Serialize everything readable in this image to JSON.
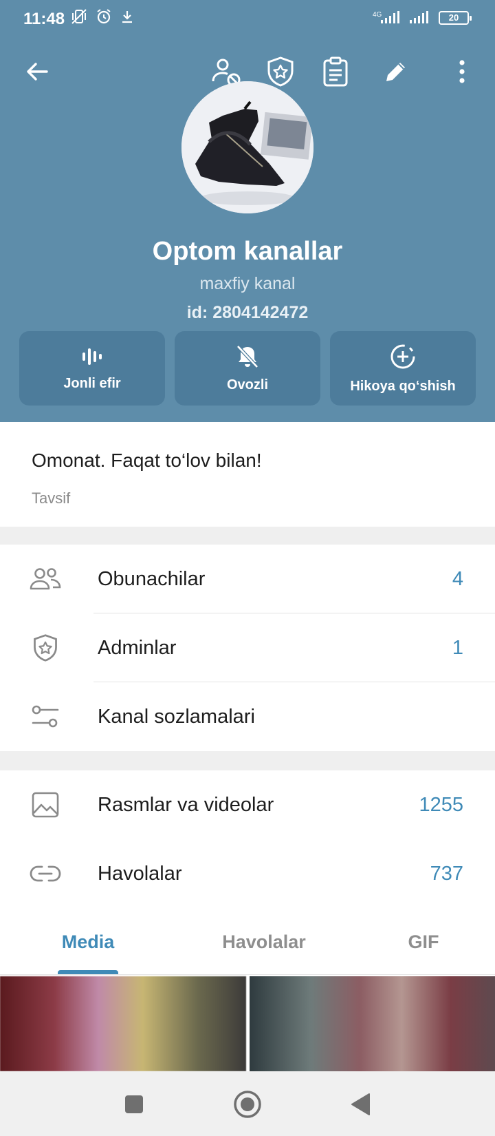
{
  "status_bar": {
    "time": "11:48",
    "battery": "20",
    "network": "4G"
  },
  "toolbar": {
    "back_icon": "back-arrow-icon",
    "icons": [
      "user-block-icon",
      "shield-star-icon",
      "clipboard-icon",
      "pencil-icon",
      "more-vertical-icon"
    ]
  },
  "channel": {
    "title": "Optom kanallar",
    "subtitle": "maxfiy kanal",
    "id_prefix": "id: ",
    "id": "2804142472"
  },
  "actions": [
    {
      "label": "Jonli efir",
      "icon": "live-stream-icon"
    },
    {
      "label": "Ovozli",
      "icon": "bell-off-icon"
    },
    {
      "label": "Hikoya qo‘shish",
      "icon": "add-story-icon"
    }
  ],
  "description": {
    "text": "Omonat. Faqat to‘lov bilan!",
    "label": "Tavsif"
  },
  "info_rows": [
    {
      "label": "Obunachilar",
      "value": "4",
      "icon": "users-icon"
    },
    {
      "label": "Adminlar",
      "value": "1",
      "icon": "shield-star-icon"
    },
    {
      "label": "Kanal sozlamalari",
      "value": "",
      "icon": "settings-sliders-icon"
    }
  ],
  "media_rows": [
    {
      "label": "Rasmlar va videolar",
      "value": "1255",
      "icon": "image-icon"
    },
    {
      "label": "Havolalar",
      "value": "737",
      "icon": "link-icon"
    }
  ],
  "tabs": [
    {
      "label": "Media",
      "active": true
    },
    {
      "label": "Havolalar",
      "active": false
    },
    {
      "label": "GIF",
      "active": false
    }
  ],
  "colors": {
    "header": "#5e8daa",
    "action_button": "#4d7c9b",
    "accent": "#3f8ab7"
  }
}
